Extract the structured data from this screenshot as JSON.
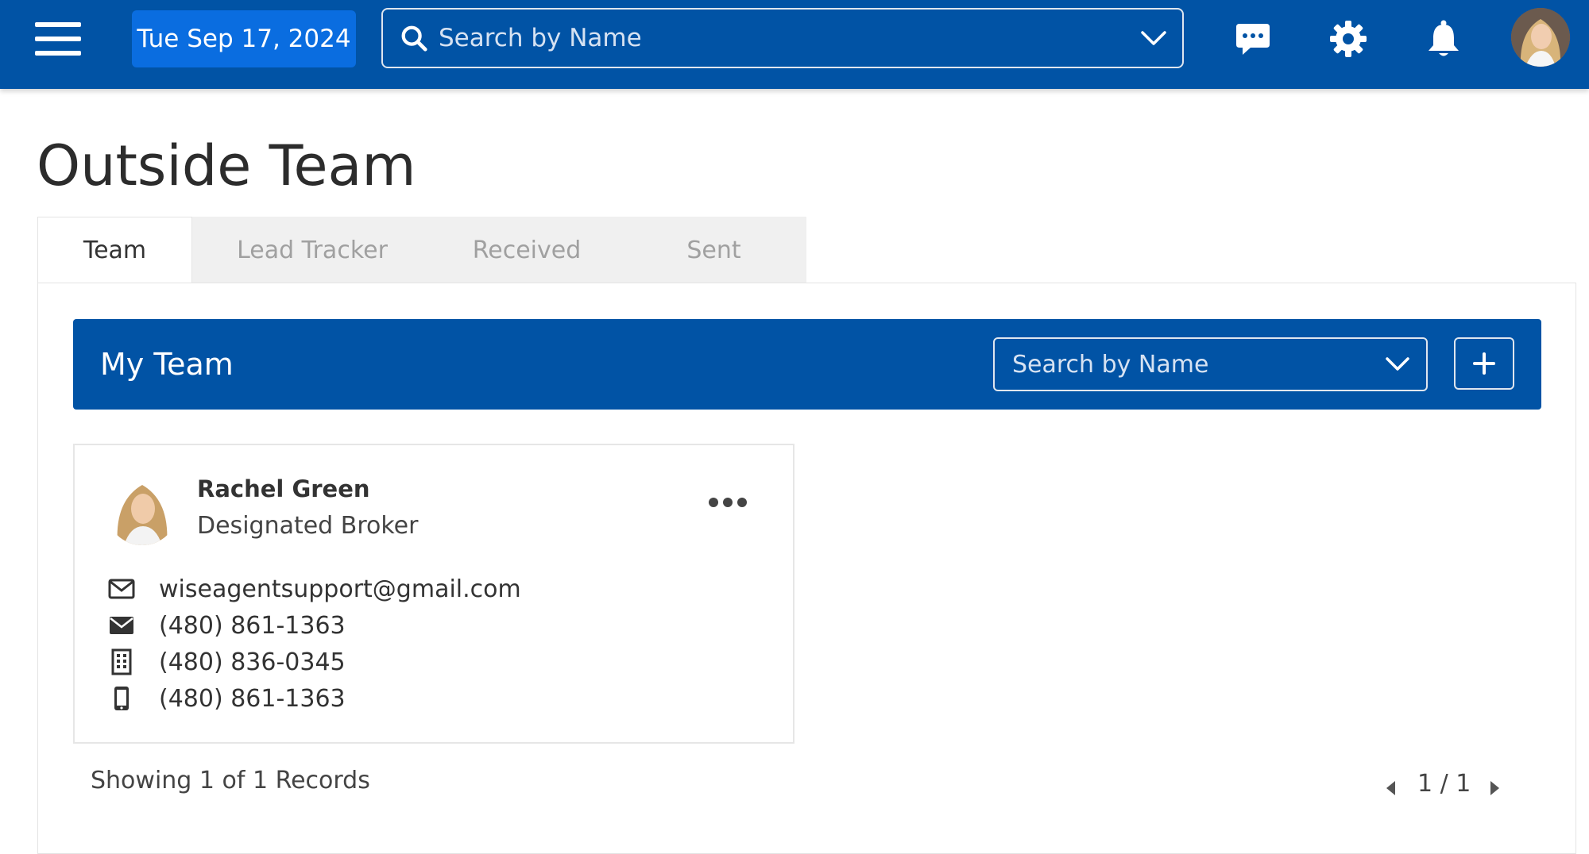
{
  "topbar": {
    "date": "Tue Sep 17, 2024",
    "search_placeholder": "Search by Name",
    "icons": [
      "menu-icon",
      "search-icon",
      "chevron-down-icon",
      "chat-icon",
      "gear-icon",
      "bell-icon",
      "avatar"
    ]
  },
  "page": {
    "title": "Outside Team"
  },
  "tabs": [
    {
      "label": "Team",
      "active": true
    },
    {
      "label": "Lead Tracker",
      "active": false
    },
    {
      "label": "Received",
      "active": false
    },
    {
      "label": "Sent",
      "active": false
    }
  ],
  "my_team": {
    "title": "My Team",
    "search_placeholder": "Search by Name",
    "add_icon": "plus-icon"
  },
  "members": [
    {
      "name": "Rachel Green",
      "role": "Designated Broker",
      "contacts": [
        {
          "icon": "envelope-outline-icon",
          "value": "wiseagentsupport@gmail.com"
        },
        {
          "icon": "envelope-filled-icon",
          "value": "(480) 861-1363"
        },
        {
          "icon": "building-icon",
          "value": "(480) 836-0345"
        },
        {
          "icon": "mobile-phone-icon",
          "value": "(480) 861-1363"
        }
      ]
    }
  ],
  "footer": {
    "records_text": "Showing 1 of 1 Records",
    "pager_text": "1 / 1"
  },
  "colors": {
    "brand_blue": "#0153a5",
    "date_chip": "#0a6de0",
    "tab_inactive_bg": "#f0f0f0"
  }
}
